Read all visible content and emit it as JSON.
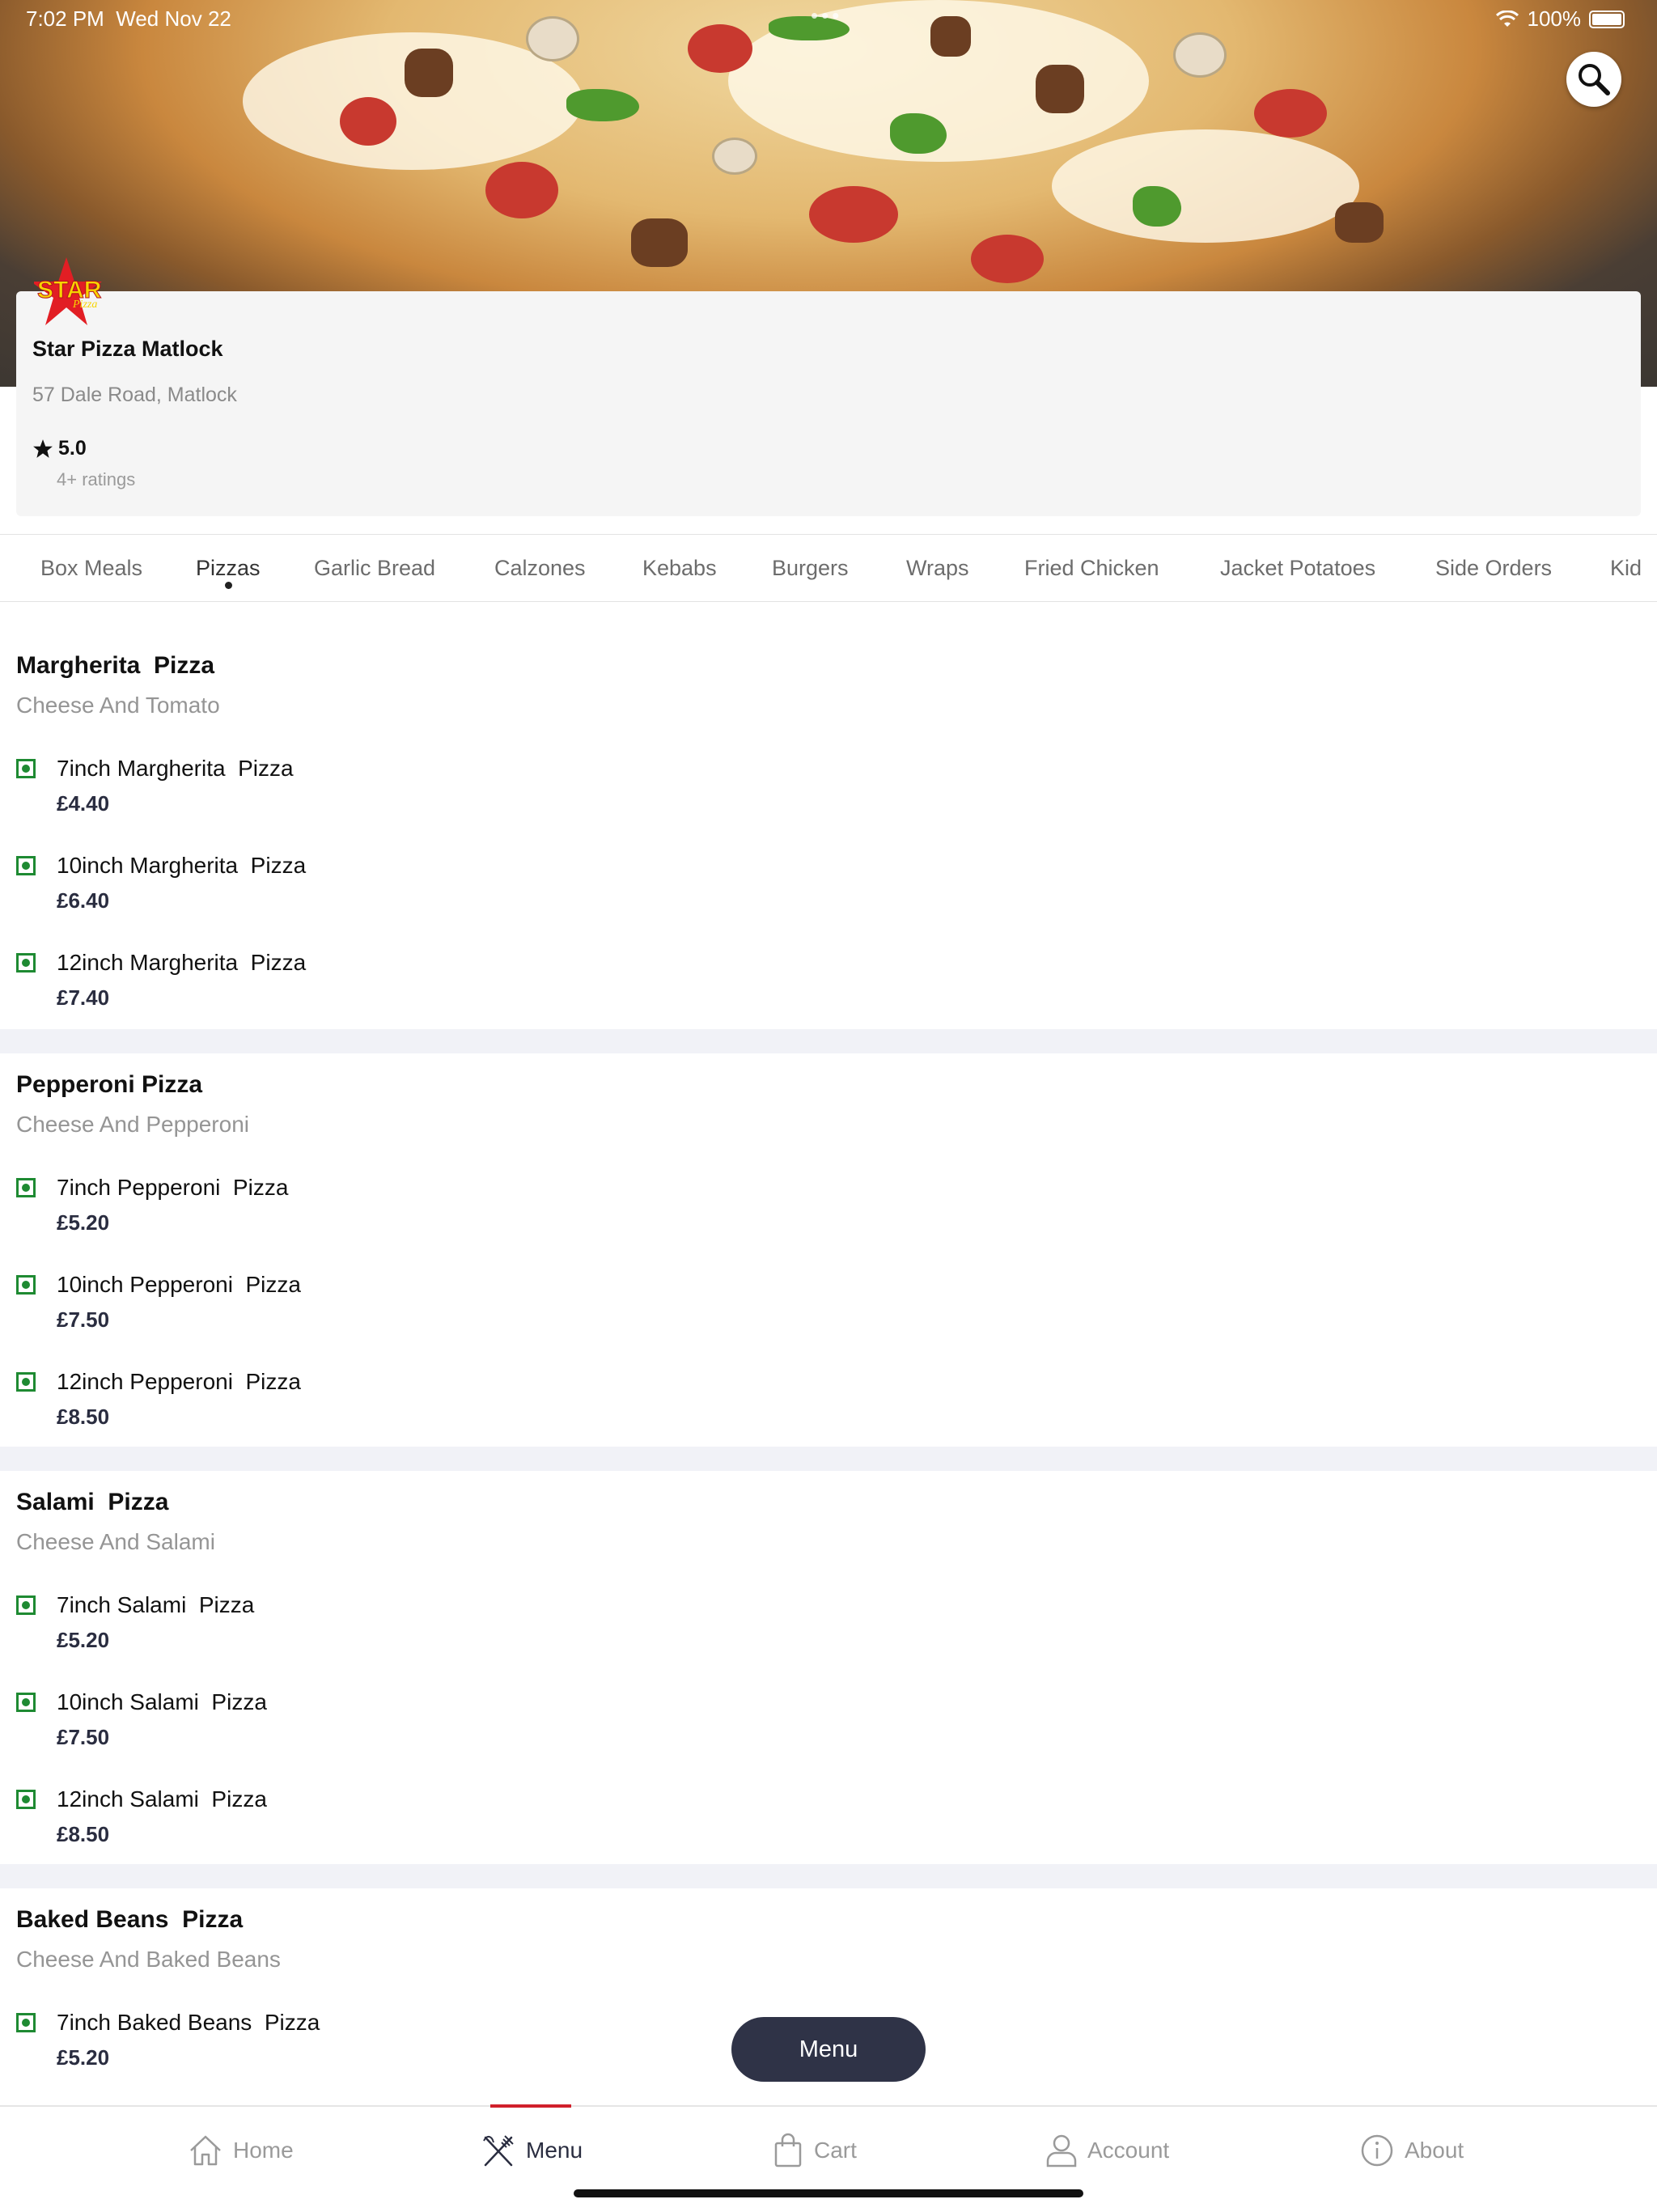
{
  "status_bar": {
    "time": "7:02 PM",
    "date": "Wed Nov 22",
    "dots": "•••",
    "battery": "100%"
  },
  "store": {
    "logo_text": "STAR",
    "logo_subtext": "Pizza",
    "name": "Star Pizza Matlock",
    "address": "57 Dale Road, Matlock",
    "rating": "5.0",
    "rating_count": "4+ ratings"
  },
  "categories": [
    {
      "label": "Box Meals"
    },
    {
      "label": "Pizzas",
      "active": true
    },
    {
      "label": "Garlic Bread"
    },
    {
      "label": "Calzones"
    },
    {
      "label": "Kebabs"
    },
    {
      "label": "Burgers"
    },
    {
      "label": "Wraps"
    },
    {
      "label": "Fried Chicken"
    },
    {
      "label": "Jacket Potatoes"
    },
    {
      "label": "Side Orders"
    },
    {
      "label": "Kid"
    }
  ],
  "sections": [
    {
      "title": "Margherita  Pizza",
      "description": "Cheese And Tomato",
      "items": [
        {
          "name": "7inch Margherita  Pizza",
          "price": "£4.40"
        },
        {
          "name": "10inch Margherita  Pizza",
          "price": "£6.40"
        },
        {
          "name": "12inch Margherita  Pizza",
          "price": "£7.40"
        }
      ]
    },
    {
      "title": "Pepperoni Pizza",
      "description": "Cheese And Pepperoni",
      "items": [
        {
          "name": "7inch Pepperoni  Pizza",
          "price": "£5.20"
        },
        {
          "name": "10inch Pepperoni  Pizza",
          "price": "£7.50"
        },
        {
          "name": "12inch Pepperoni  Pizza",
          "price": "£8.50"
        }
      ]
    },
    {
      "title": "Salami  Pizza",
      "description": "Cheese And Salami",
      "items": [
        {
          "name": "7inch Salami  Pizza",
          "price": "£5.20"
        },
        {
          "name": "10inch Salami  Pizza",
          "price": "£7.50"
        },
        {
          "name": "12inch Salami  Pizza",
          "price": "£8.50"
        }
      ]
    },
    {
      "title": "Baked Beans  Pizza",
      "description": "Cheese And Baked Beans",
      "items": [
        {
          "name": "7inch Baked Beans  Pizza",
          "price": "£5.20"
        }
      ]
    }
  ],
  "floating_button": {
    "label": "Menu"
  },
  "bottom_nav": [
    {
      "label": "Home",
      "icon": "home-icon"
    },
    {
      "label": "Menu",
      "icon": "fork-knife-icon",
      "active": true
    },
    {
      "label": "Cart",
      "icon": "shopping-bag-icon"
    },
    {
      "label": "Account",
      "icon": "user-icon"
    },
    {
      "label": "About",
      "icon": "info-icon"
    }
  ],
  "colors": {
    "accent_dark": "#2f3347",
    "active_indicator": "#d0202b",
    "veg_green": "#1e8a32",
    "muted_text": "#959595"
  }
}
